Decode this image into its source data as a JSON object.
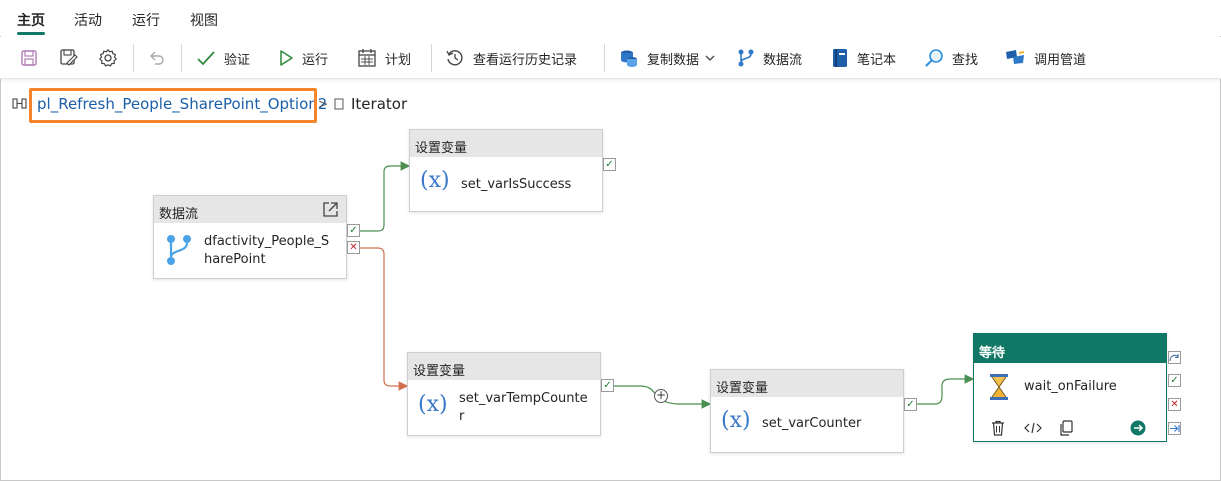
{
  "tabs": [
    {
      "label": "主页"
    },
    {
      "label": "活动"
    },
    {
      "label": "运行"
    },
    {
      "label": "视图"
    }
  ],
  "toolbar": {
    "save_icon": "save-icon",
    "save_as_icon": "save-as-icon",
    "settings_icon": "gear-icon",
    "undo_icon": "undo-icon",
    "validate": "验证",
    "run": "运行",
    "schedule": "计划",
    "history": "查看运行历史记录",
    "copy_data": "复制数据",
    "dataflow": "数据流",
    "notebook": "笔记本",
    "find": "查找",
    "invoke_pipeline": "调用管道"
  },
  "breadcrumb": {
    "pipeline": "pl_Refresh_People_SharePoint_Option2",
    "separator": ">",
    "current": "Iterator"
  },
  "nodes": {
    "dataflow": {
      "type": "数据流",
      "name_line1": "dfactivity_People_S",
      "name_line2": "harePoint"
    },
    "set_success": {
      "type": "设置变量",
      "name": "set_varIsSuccess"
    },
    "set_temp": {
      "type": "设置变量",
      "name_line1": "set_varTempCounte",
      "name_line2": "r"
    },
    "set_counter": {
      "type": "设置变量",
      "name": "set_varCounter"
    },
    "wait": {
      "type": "等待",
      "name": "wait_onFailure"
    }
  },
  "glyphs": {
    "var": "(x)",
    "ok": "✓",
    "bad": "✕",
    "plus": "+"
  },
  "colors": {
    "accent": "#117865",
    "success_wire": "#4a8f4f",
    "failure_wire": "#d0704f",
    "highlight": "#f5852a"
  }
}
